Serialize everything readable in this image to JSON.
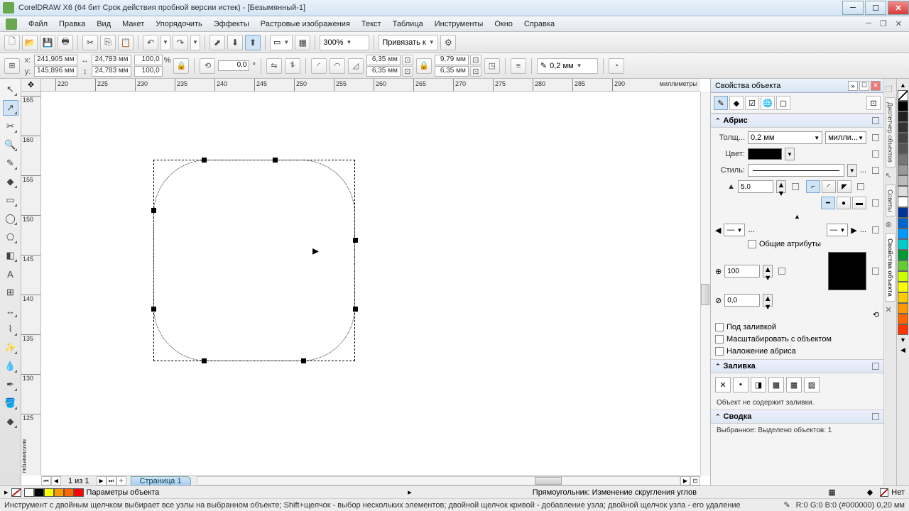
{
  "window": {
    "title": "CorelDRAW X6 (64 бит Срок действия пробной версии истек) - [Безымянный-1]"
  },
  "menu": {
    "items": [
      "Файл",
      "Правка",
      "Вид",
      "Макет",
      "Упорядочить",
      "Эффекты",
      "Растровые изображения",
      "Текст",
      "Таблица",
      "Инструменты",
      "Окно",
      "Справка"
    ]
  },
  "toolbar": {
    "zoom": "300%",
    "snap": "Привязать к"
  },
  "property_bar": {
    "x_label": "x:",
    "x": "241,905 мм",
    "y_label": "y:",
    "y": "145,896 мм",
    "w": "24,783 мм",
    "h": "24,783 мм",
    "sx": "100,0",
    "sy": "100,0",
    "percent": "%",
    "angle": "0,0",
    "deg": "°",
    "cr1": "6,35 мм",
    "cr2": "6,35 мм",
    "cr3": "9,79 мм",
    "cr4": "6,35 мм",
    "outline_width": "0,2 мм"
  },
  "ruler": {
    "unit": "миллиметры",
    "unit_v": "миллиметры",
    "h_ticks": [
      "220",
      "225",
      "230",
      "235",
      "240",
      "245",
      "250",
      "255",
      "260",
      "265",
      "270",
      "275",
      "280",
      "285",
      "290"
    ],
    "v_ticks": [
      "165",
      "160",
      "155",
      "150",
      "145",
      "140",
      "135",
      "130",
      "125"
    ]
  },
  "pages": {
    "counter": "1 из 1",
    "tab": "Страница 1"
  },
  "docker": {
    "title": "Свойства объекта",
    "tab_hints": "Советы",
    "tab_mgr": "Диспетчер объектов",
    "tab_props": "Свойства объекта",
    "outline_section": "Абрис",
    "width_label": "Толщ...",
    "width_val": "0,2 мм",
    "width_unit": "милли...",
    "color_label": "Цвет:",
    "style_label": "Стиль:",
    "style_more": "...",
    "miter": "5,0",
    "arrow_more": "...",
    "shared_attrs": "Общие атрибуты",
    "opacity": "100",
    "offset": "0,0",
    "behind_fill": "Под заливкой",
    "scale_with": "Масштабировать с объектом",
    "overprint": "Наложение абриса",
    "fill_section": "Заливка",
    "no_fill_msg": "Объект не содержит заливки.",
    "summary_section": "Сводка",
    "summary_text": "Выбранное: Выделено объектов: 1"
  },
  "status": {
    "param_label": "Параметры объекта",
    "center": "Прямоугольник: Изменение скругления углов",
    "fill_none": "Нет",
    "outline_info": "R:0 G:0 B:0 (#000000) 0,20 мм",
    "hint": "Инструмент с двойным щелчком выбирает все узлы на выбранном объекте; Shift+щелчок - выбор нескольких элементов; двойной щелчок кривой - добавление узла; двойной щелчок узла - его удаление"
  },
  "palette_colors": [
    "#000000",
    "#222222",
    "#333333",
    "#444444",
    "#555555",
    "#777777",
    "#999999",
    "#bbbbbb",
    "#dddddd",
    "#ffffff",
    "#003399",
    "#0066cc",
    "#0099ff",
    "#00cccc",
    "#009933",
    "#66cc33",
    "#ccff00",
    "#ffff00",
    "#ffcc00",
    "#ff9900",
    "#ff6600",
    "#ff3300"
  ],
  "mini_palette": [
    "#ffffff",
    "#000000",
    "#ffff00",
    "#ff9900",
    "#ff6600",
    "#ff0000"
  ]
}
